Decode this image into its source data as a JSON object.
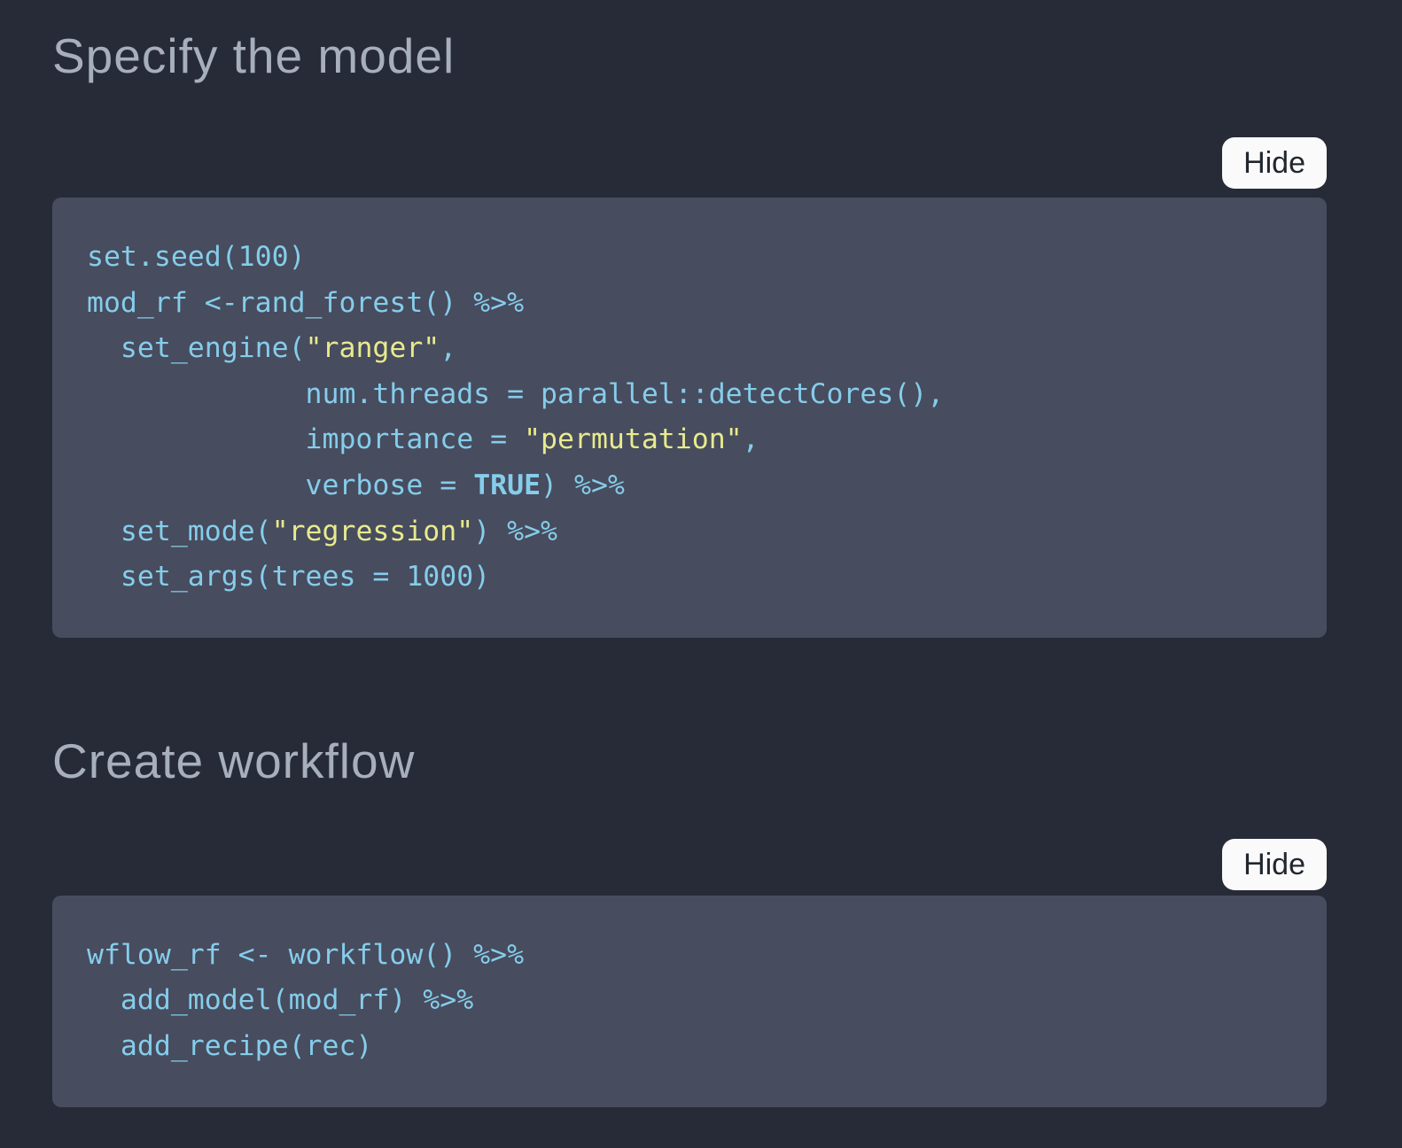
{
  "colors": {
    "page_bg": "#272b37",
    "block_bg": "#474c5e",
    "code_default": "#85cdeb",
    "code_string": "#e8ea8e",
    "heading": "#a7afbc",
    "button_bg": "#fafafa",
    "button_text": "#21262f"
  },
  "sections": [
    {
      "heading": "Specify the model",
      "hide_button": "Hide",
      "code_lines": [
        [
          {
            "t": "set.seed(100)",
            "c": "d"
          }
        ],
        [
          {
            "t": "mod_rf <-rand_forest() %>%",
            "c": "d"
          }
        ],
        [
          {
            "t": "  set_engine(",
            "c": "d"
          },
          {
            "t": "\"ranger\"",
            "c": "s"
          },
          {
            "t": ",",
            "c": "d"
          }
        ],
        [
          {
            "t": "             num.threads = parallel::detectCores(),",
            "c": "d"
          }
        ],
        [
          {
            "t": "             importance = ",
            "c": "d"
          },
          {
            "t": "\"permutation\"",
            "c": "s"
          },
          {
            "t": ",",
            "c": "d"
          }
        ],
        [
          {
            "t": "             verbose = ",
            "c": "d"
          },
          {
            "t": "TRUE",
            "c": "b"
          },
          {
            "t": ") %>%",
            "c": "d"
          }
        ],
        [
          {
            "t": "  set_mode(",
            "c": "d"
          },
          {
            "t": "\"regression\"",
            "c": "s"
          },
          {
            "t": ") %>%",
            "c": "d"
          }
        ],
        [
          {
            "t": "  set_args(trees = 1000)",
            "c": "d"
          }
        ]
      ]
    },
    {
      "heading": "Create workflow",
      "hide_button": "Hide",
      "code_lines": [
        [
          {
            "t": "wflow_rf <- workflow() %>%",
            "c": "d"
          }
        ],
        [
          {
            "t": "  add_model(mod_rf) %>%",
            "c": "d"
          }
        ],
        [
          {
            "t": "  add_recipe(rec)",
            "c": "d"
          }
        ]
      ]
    }
  ]
}
